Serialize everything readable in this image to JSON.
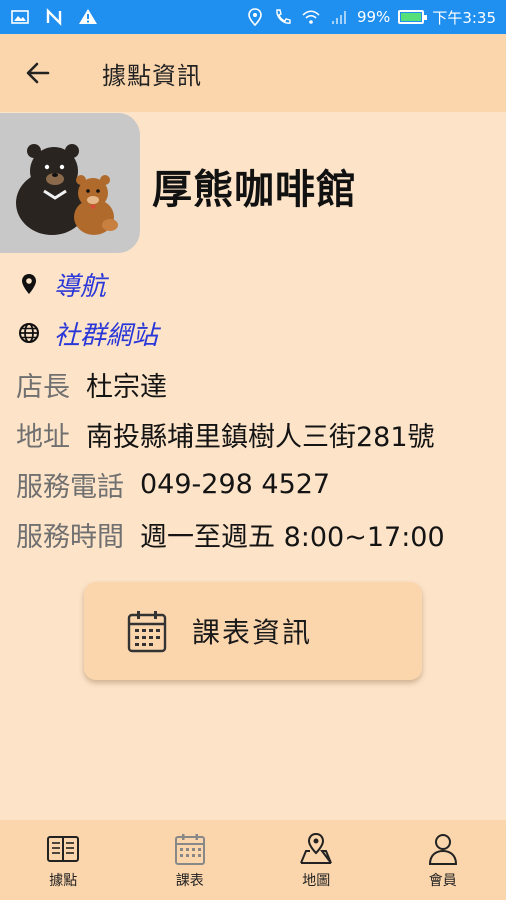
{
  "status_bar": {
    "battery_text": "99%",
    "time": "下午3:35",
    "battery_level": 0.99,
    "icons": [
      "gallery-icon",
      "n-icon",
      "warning-icon",
      "location-icon",
      "call-wifi-icon",
      "wifi-icon",
      "signal-icon",
      "battery-icon"
    ]
  },
  "app_bar": {
    "title": "據點資訊",
    "back_icon": "arrow-left-icon"
  },
  "store": {
    "name": "厚熊咖啡館",
    "avatar": "bear-mascot-image",
    "navigation_link": "導航",
    "social_link": "社群網站"
  },
  "info": {
    "manager_label": "店長",
    "manager_value": "杜宗達",
    "address_label": "地址",
    "address_value": "南投縣埔里鎮樹人三街281號",
    "phone_label": "服務電話",
    "phone_value": "049-298 4527",
    "hours_label": "服務時間",
    "hours_value": "週一至週五 8:00~17:00"
  },
  "schedule_button": {
    "label": "課表資訊",
    "icon": "calendar-icon"
  },
  "bottom_nav": {
    "items": [
      {
        "label": "據點",
        "icon": "book-icon"
      },
      {
        "label": "課表",
        "icon": "calendar-icon"
      },
      {
        "label": "地圖",
        "icon": "map-icon"
      },
      {
        "label": "會員",
        "icon": "person-icon"
      }
    ]
  },
  "colors": {
    "status_bar": "#1f8ff0",
    "background": "#fde4c9",
    "accent": "#fbd6ad",
    "link": "#2a37d8"
  }
}
